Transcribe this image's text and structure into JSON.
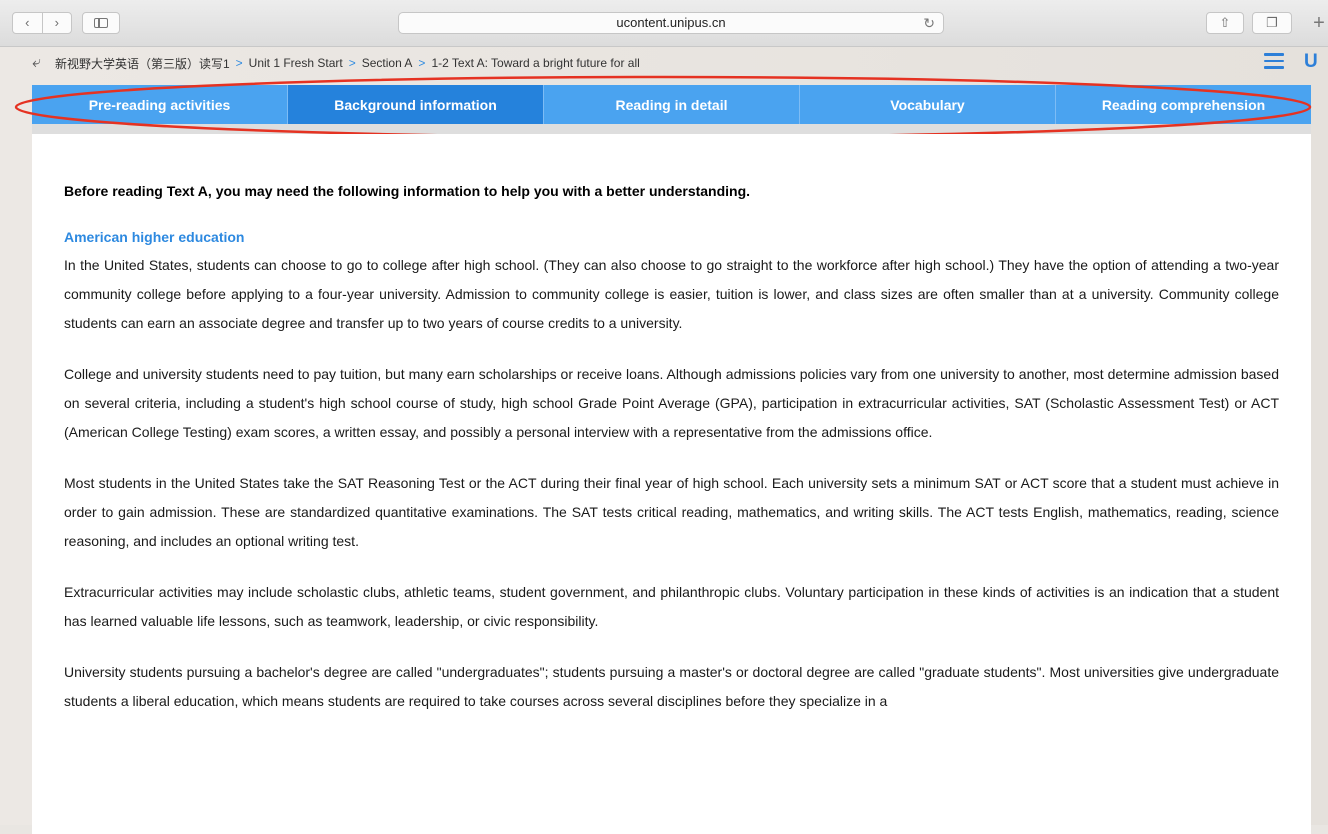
{
  "browser": {
    "url": "ucontent.unipus.cn",
    "icons": [
      "chevron-left-icon",
      "chevron-right-icon",
      "sidebar-icon",
      "reload-icon",
      "share-icon",
      "tabs-icon",
      "plus-icon"
    ]
  },
  "breadcrumb": {
    "items": [
      "新视野大学英语（第三版）读写1",
      "Unit 1 Fresh Start",
      "Section A",
      "1-2 Text A: Toward a bright future for all"
    ]
  },
  "brand": {
    "logo_text": "U"
  },
  "tabs": [
    {
      "label": "Pre-reading activities",
      "active": false
    },
    {
      "label": "Background information",
      "active": true
    },
    {
      "label": "Reading in detail",
      "active": false
    },
    {
      "label": "Vocabulary",
      "active": false
    },
    {
      "label": "Reading comprehension",
      "active": false
    }
  ],
  "colors": {
    "tab_bg": "#4aa3f0",
    "tab_active": "#2582dc",
    "heading": "#2d89e0",
    "annotation": "#e53222"
  },
  "content": {
    "intro": "Before reading Text A, you may need the following information to help you with a better understanding.",
    "section_heading": "American higher education",
    "paragraphs": [
      "In the United States, students can choose to go to college after high school. (They can also choose to go straight to the workforce after high school.) They have the option of attending a two-year community college before applying to a four-year university. Admission to community college is easier, tuition is lower, and class sizes are often smaller than at a university. Community college students can earn an associate degree and transfer up to two years of course credits to a university.",
      "College and university students need to pay tuition, but many earn scholarships or receive loans. Although admissions policies vary from one university to another, most determine admission based on several criteria, including a student's high school course of study, high school Grade Point Average (GPA), participation in extracurricular activities, SAT (Scholastic Assessment Test) or ACT (American College Testing) exam scores, a written essay, and possibly a personal interview with a representative from the admissions office.",
      "Most students in the United States take the SAT Reasoning Test or the ACT during their final year of high school. Each university sets a minimum SAT or ACT score that a student must achieve in order to gain admission. These are standardized quantitative examinations. The SAT tests critical reading, mathematics, and writing skills. The ACT tests English, mathematics, reading, science reasoning, and includes an optional writing test.",
      "Extracurricular activities may include scholastic clubs, athletic teams, student government, and philanthropic clubs. Voluntary participation in these kinds of activities is an indication that a student has learned valuable life lessons, such as teamwork, leadership, or civic responsibility.",
      "University students pursuing a bachelor's degree are called \"undergraduates\"; students pursuing a master's or doctoral degree are called \"graduate students\". Most universities give undergraduate students a liberal education, which means students are required to take courses across several disciplines before they specialize in a"
    ]
  }
}
